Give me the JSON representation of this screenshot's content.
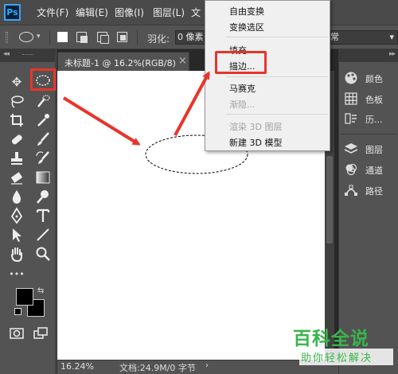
{
  "app": {
    "logo": "Ps"
  },
  "menubar": {
    "items": [
      {
        "label": "文件(F)"
      },
      {
        "label": "编辑(E)"
      },
      {
        "label": "图像(I)"
      },
      {
        "label": "图层(L)"
      },
      {
        "label": "文"
      }
    ]
  },
  "options": {
    "feather_label": "羽化:",
    "feather_value": "0 像素",
    "style_value": "常"
  },
  "document": {
    "tab_title": "未标题-1 @ 16.2%(RGB/8)",
    "close_glyph": "×",
    "zoom": "16.24%",
    "doc_info": "文档:24.9M/0 字节",
    "status_arrow": "›"
  },
  "context_menu": {
    "items": [
      {
        "label": "自由变换",
        "enabled": true
      },
      {
        "label": "变换选区",
        "enabled": true
      },
      {
        "label": "填充...",
        "enabled": true
      },
      {
        "label": "描边...",
        "enabled": true,
        "highlighted": true
      },
      {
        "label": "马赛克",
        "enabled": true
      },
      {
        "label": "渐隐...",
        "enabled": false
      },
      {
        "label": "渲染 3D 图层",
        "enabled": false
      },
      {
        "label": "新建 3D 模型",
        "enabled": true
      }
    ]
  },
  "panels": {
    "items": [
      {
        "label": "颜色",
        "icon": "palette-icon"
      },
      {
        "label": "色板",
        "icon": "swatches-grid-icon"
      },
      {
        "label": "历...",
        "icon": "history-icon"
      },
      {
        "label": "图层",
        "icon": "layers-icon"
      },
      {
        "label": "通道",
        "icon": "channels-icon"
      },
      {
        "label": "路径",
        "icon": "paths-icon"
      }
    ]
  },
  "colors": {
    "annotation_red": "#e8342b",
    "foreground": "#000000",
    "background": "#000000",
    "watermark_green": "#38b64a"
  },
  "watermark": {
    "main": "百科全说",
    "sub": "助你轻松解决"
  }
}
